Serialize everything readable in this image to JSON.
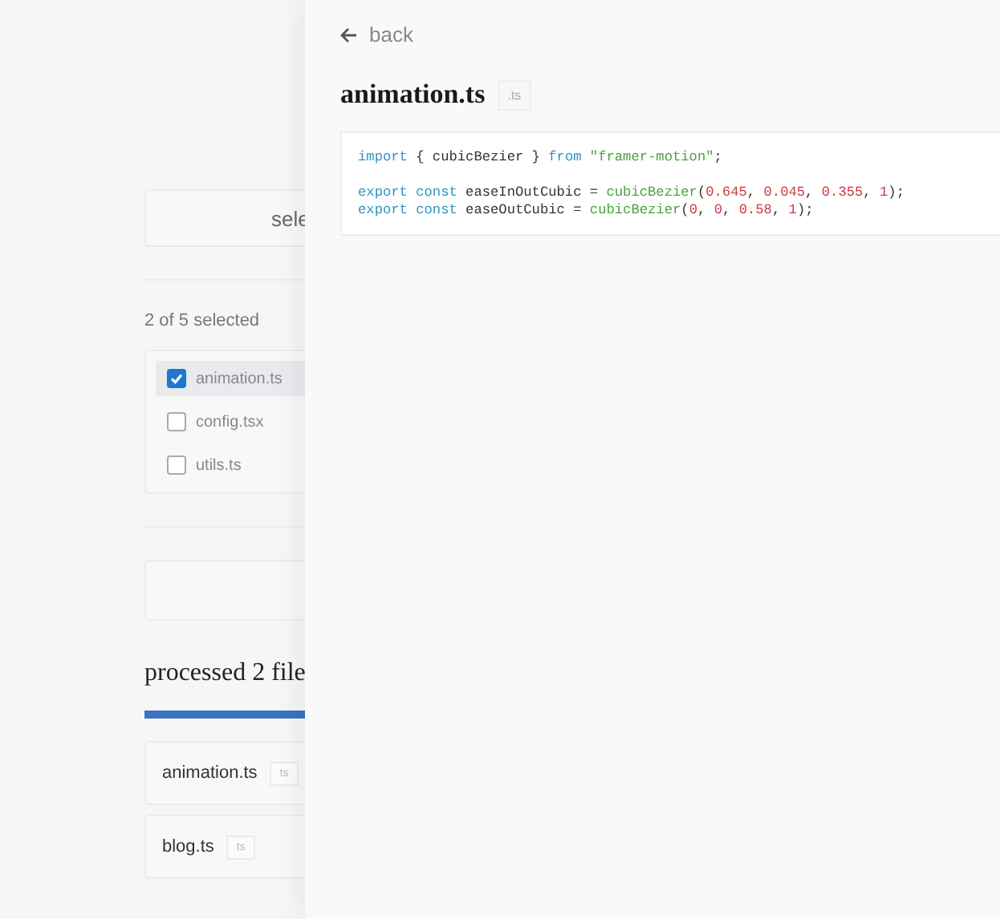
{
  "background": {
    "select_card": {
      "label": "sele"
    },
    "selection_count": "2 of 5 selected",
    "files": [
      {
        "name": "animation.ts",
        "checked": true,
        "selected": true
      },
      {
        "name": "config.tsx",
        "checked": false,
        "selected": false
      },
      {
        "name": "utils.ts",
        "checked": false,
        "selected": false
      }
    ],
    "heading": "processed 2 file",
    "progress": {
      "level": 1
    },
    "processed_files": [
      {
        "name": "animation.ts",
        "tag": "ts"
      },
      {
        "name": "blog.ts",
        "tag": "ts"
      }
    ]
  },
  "drawer": {
    "back_label": "back",
    "title": "animation.ts",
    "tag": ".ts",
    "code_lines": [
      {
        "spaced": false,
        "tokens": [
          {
            "kind": "keyword",
            "text": "import"
          },
          {
            "kind": "plain",
            "text": " { cubicBezier } "
          },
          {
            "kind": "keyword",
            "text": "from"
          },
          {
            "kind": "string",
            "text": " \"framer-motion\""
          },
          {
            "kind": "plain",
            "text": ";"
          }
        ]
      },
      {
        "spaced": true,
        "tokens": [
          {
            "kind": "keyword",
            "text": "export const"
          },
          {
            "kind": "plain",
            "text": " easeInOutCubic = "
          },
          {
            "kind": "function",
            "text": "cubicBezier"
          },
          {
            "kind": "plain",
            "text": "("
          },
          {
            "kind": "number",
            "text": "0.645"
          },
          {
            "kind": "plain",
            "text": ", "
          },
          {
            "kind": "number",
            "text": "0.045"
          },
          {
            "kind": "plain",
            "text": ", "
          },
          {
            "kind": "number",
            "text": "0.355"
          },
          {
            "kind": "plain",
            "text": ", "
          },
          {
            "kind": "number",
            "text": "1"
          },
          {
            "kind": "plain",
            "text": ");"
          }
        ]
      },
      {
        "spaced": false,
        "tokens": [
          {
            "kind": "keyword",
            "text": "export const"
          },
          {
            "kind": "plain",
            "text": " easeOutCubic = "
          },
          {
            "kind": "function",
            "text": "cubicBezier"
          },
          {
            "kind": "plain",
            "text": "("
          },
          {
            "kind": "number",
            "text": "0"
          },
          {
            "kind": "plain",
            "text": ", "
          },
          {
            "kind": "number",
            "text": "0"
          },
          {
            "kind": "plain",
            "text": ", "
          },
          {
            "kind": "number",
            "text": "0.58"
          },
          {
            "kind": "plain",
            "text": ", "
          },
          {
            "kind": "number",
            "text": "1"
          },
          {
            "kind": "plain",
            "text": ");"
          }
        ]
      }
    ]
  }
}
